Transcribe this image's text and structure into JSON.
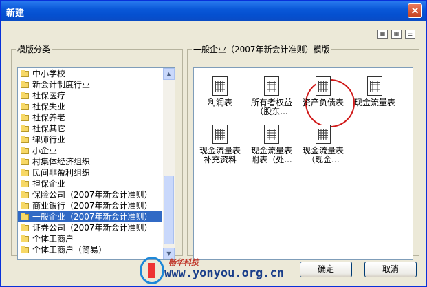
{
  "window": {
    "title": "新建",
    "close": "×"
  },
  "left_panel": {
    "legend": "模版分类",
    "items": [
      "中小学校",
      "新会计制度行业",
      "社保医疗",
      "社保失业",
      "社保养老",
      "社保其它",
      "律师行业",
      "小企业",
      "村集体经济组织",
      "民间非盈利组织",
      "担保企业",
      "保险公司（2007年新会计准则）",
      "商业银行（2007年新会计准则）",
      "一般企业（2007年新会计准则）",
      "证券公司（2007年新会计准则）",
      "个体工商户",
      "个体工商户（简易）"
    ],
    "selected_index": 13
  },
  "right_panel": {
    "legend": "一般企业（2007年新会计准则）模版",
    "templates": [
      {
        "lines": [
          "利润表"
        ]
      },
      {
        "lines": [
          "所有者权益",
          "（股东..."
        ]
      },
      {
        "lines": [
          "资产负债表"
        ]
      },
      {
        "lines": [
          "现金流量表"
        ]
      },
      {
        "lines": [
          "现金流量表",
          "补充资料"
        ]
      },
      {
        "lines": [
          "现金流量表",
          "附表（处..."
        ]
      },
      {
        "lines": [
          "现金流量表",
          "（现金..."
        ]
      }
    ],
    "highlighted_index": 2
  },
  "buttons": {
    "ok": "确定",
    "cancel": "取消"
  },
  "watermark": {
    "brand": "畅华科技",
    "url": "www.yonyou.org.cn"
  },
  "colors": {
    "title_bar": "#0a58d8",
    "selection": "#316ac5",
    "highlight_circle": "#d01818"
  }
}
